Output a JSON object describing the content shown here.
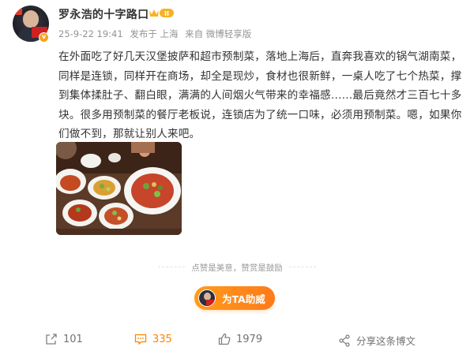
{
  "author": {
    "name": "罗永浩的十字路口",
    "vip_badge_text": "II"
  },
  "post_meta": {
    "time": "25-9-22 19:41",
    "published_in": "发布于 上海",
    "source": "来自 微博轻享版"
  },
  "content": "在外面吃了好几天汉堡披萨和超市预制菜，落地上海后，直奔我喜欢的锅气湖南菜，同样是连锁，同样开在商场，却全是现炒，食材也很新鲜，一桌人吃了七个热菜，撑到集体揉肚子、翻白眼，满满的人间烟火气带来的幸福感……最后竟然才三百七十多块。很多用预制菜的餐厅老板说，连锁店为了统一口味，必须用预制菜。嗯，如果你们做不到，那就让别人来吧。",
  "reward": {
    "divider_text": "点赞是美意，赞赏是鼓励",
    "button_label": "为TA助威"
  },
  "actions": {
    "forward_count": "101",
    "comment_count": "335",
    "like_count": "1979",
    "share_label": "分享这条博文"
  },
  "colors": {
    "accent": "#ff8200",
    "button": "#ff9c1a",
    "meta_text": "#939393"
  }
}
